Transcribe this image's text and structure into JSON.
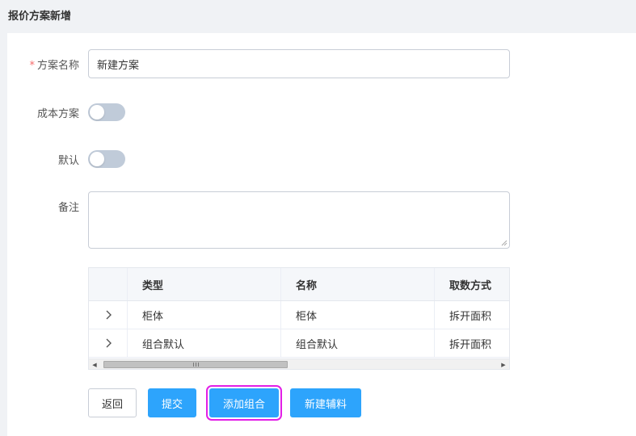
{
  "header": {
    "title": "报价方案新增"
  },
  "form": {
    "name_label": "方案名称",
    "required_mark": "*",
    "name_value": "新建方案",
    "cost_label": "成本方案",
    "cost_on": false,
    "default_label": "默认",
    "default_on": false,
    "remark_label": "备注",
    "remark_value": ""
  },
  "table": {
    "columns": [
      "类型",
      "名称",
      "取数方式"
    ],
    "rows": [
      {
        "type": "柜体",
        "name": "柜体",
        "method": "拆开面积"
      },
      {
        "type": "组合默认",
        "name": "组合默认",
        "method": "拆开面积"
      }
    ],
    "scroll_left": "◀",
    "scroll_right": "▶"
  },
  "buttons": {
    "back": "返回",
    "submit": "提交",
    "add_group": "添加组合",
    "new_accessory": "新建辅料"
  },
  "colors": {
    "primary": "#2da4fc",
    "highlight": "#e21fe6",
    "required": "#f56c6c"
  },
  "icons": {
    "row_expand": "chevron-right-icon",
    "resize": "resize-grip-icon"
  }
}
